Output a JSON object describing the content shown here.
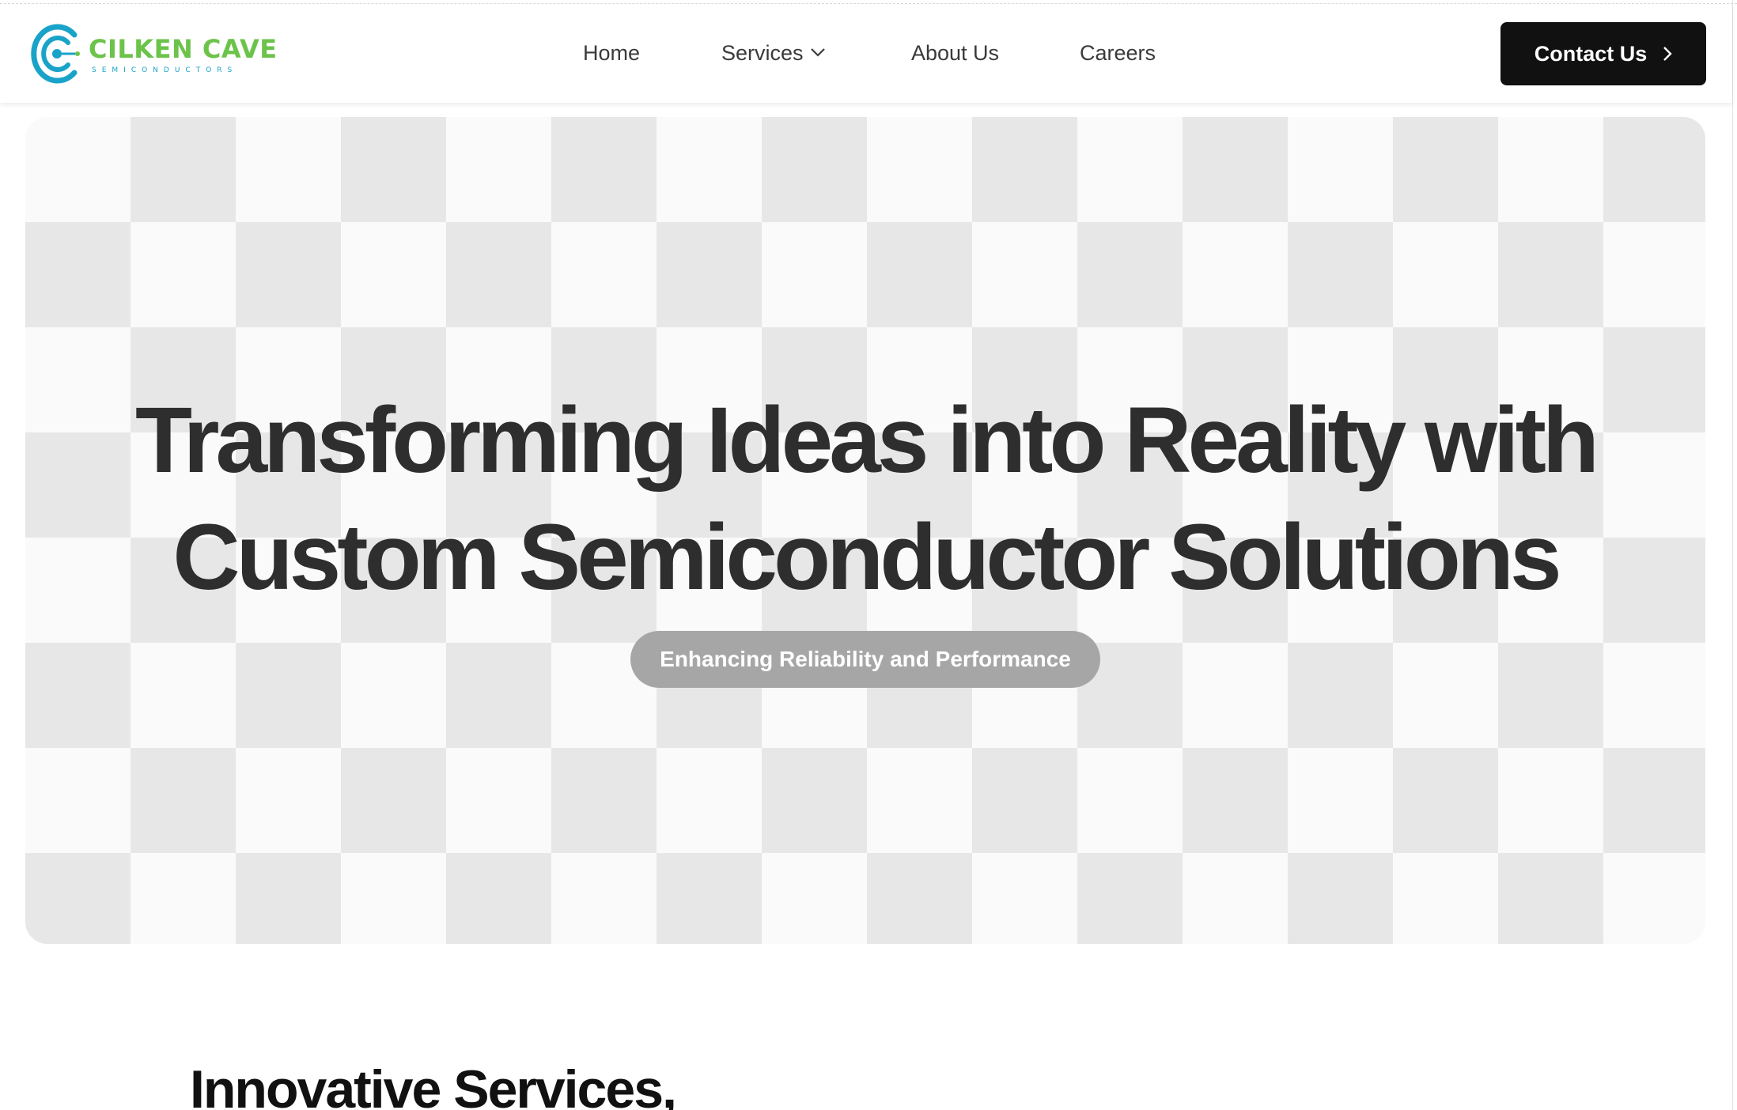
{
  "header": {
    "logo": {
      "name": "CILKEN CAVE",
      "tagline": "SEMICONDUCTORS",
      "icon": "logo-c-mark-icon",
      "colors": {
        "primary": "#1aa3c9",
        "secondary": "#6cc34a"
      }
    },
    "nav": [
      {
        "label": "Home"
      },
      {
        "label": "Services",
        "icon": "chevron-down-icon"
      },
      {
        "label": "About Us"
      },
      {
        "label": "Careers"
      }
    ],
    "cta": {
      "label": "Contact Us",
      "icon": "chevron-right-icon",
      "color": "#111111"
    }
  },
  "hero": {
    "title_line1": "Transforming Ideas into Reality with",
    "title_line2": "Custom Semiconductor Solutions",
    "badge": "Enhancing Reliability and Performance",
    "background_pattern": "checkerboard"
  },
  "services": {
    "heading": "Innovative Services,"
  }
}
